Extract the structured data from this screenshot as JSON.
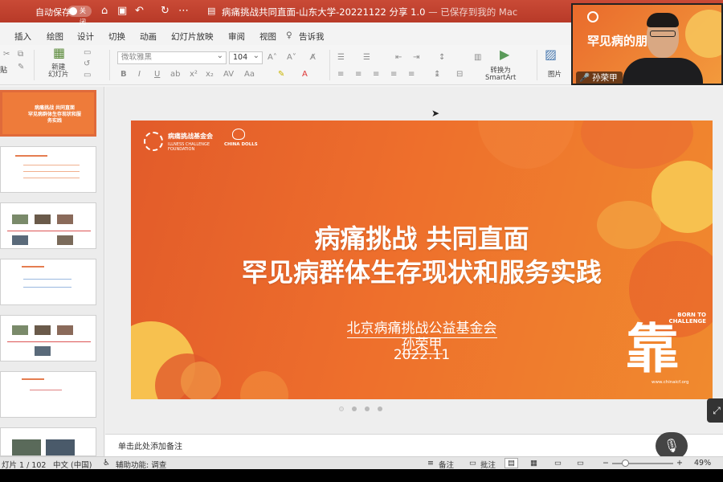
{
  "app": {
    "autosave_label": "自动保存",
    "autosave_state": "关闭",
    "doc_title": "病痛挑战共同直面-山东大学-20221122 分享 1.0",
    "doc_title_suffix": " — 已保存到我的 Mac"
  },
  "ribbon_tabs": [
    "插入",
    "绘图",
    "设计",
    "切换",
    "动画",
    "幻灯片放映",
    "审阅",
    "视图",
    "告诉我"
  ],
  "ribbon": {
    "partial_left_label": "贴",
    "new_slide_label": "新建\n幻灯片",
    "font_name": "微软雅黑",
    "font_size": "104",
    "convert_smartart_label": "转换为\nSmartArt",
    "picture_label": "图片"
  },
  "thumbnails": [
    {
      "index": 1,
      "active": true,
      "title": "病痛挑战 共同直面\n罕见病群体生存现状和服务实践"
    },
    {
      "index": 2,
      "active": false
    },
    {
      "index": 3,
      "active": false
    },
    {
      "index": 4,
      "active": false
    },
    {
      "index": 5,
      "active": false
    },
    {
      "index": 6,
      "active": false
    },
    {
      "index": 7,
      "active": false
    }
  ],
  "slide": {
    "org_name_cn": "病痛挑战基金会",
    "org_name_en_1": "ILLNESS CHALLENGE",
    "org_name_en_2": "FOUNDATION",
    "partner_logo_text": "CHINA DOLLS",
    "title_line1": "病痛挑战 共同直面",
    "title_line2": "罕见病群体生存现状和服务实践",
    "organization": "北京病痛挑战公益基金会",
    "presenter": "孙荣甲",
    "date": "2022.11",
    "born_to_challenge": "BORN TO\nCHALLENGE",
    "website": "www.chinaicf.org",
    "logo_glyph": "靠"
  },
  "notes_placeholder": "单击此处添加备注",
  "statusbar": {
    "slide_counter": "灯片 1 / 102",
    "language": "中文 (中国)",
    "accessibility": "辅助功能: 调查",
    "notes_btn": "备注",
    "comments_btn": "批注",
    "zoom_percent": "49%"
  },
  "webcam": {
    "participant_name": "孙荣甲",
    "background_text": "罕见病的朋友们"
  },
  "colors": {
    "titlebar": "#c0392b",
    "slide_orange": "#ee6f2c",
    "accent_yellow": "#f6c35a"
  }
}
